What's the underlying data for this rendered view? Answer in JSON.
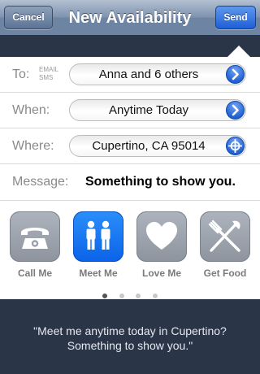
{
  "navbar": {
    "title": "New Availability",
    "cancel_label": "Cancel",
    "send_label": "Send"
  },
  "form": {
    "to": {
      "label": "To:",
      "email_label": "EMAIL",
      "sms_label": "SMS",
      "value": "Anna and 6 others"
    },
    "when": {
      "label": "When:",
      "value": "Anytime Today"
    },
    "where": {
      "label": "Where:",
      "value": "Cupertino, CA 95014"
    },
    "message": {
      "label": "Message:",
      "value": "Something to show you."
    }
  },
  "actions": [
    {
      "label": "Call Me",
      "icon": "phone-icon",
      "selected": false
    },
    {
      "label": "Meet Me",
      "icon": "people-icon",
      "selected": true
    },
    {
      "label": "Love Me",
      "icon": "heart-icon",
      "selected": false
    },
    {
      "label": "Get Food",
      "icon": "fork-knife-icon",
      "selected": false
    }
  ],
  "pager": {
    "page_count": 4,
    "current_page": 1
  },
  "preview": {
    "line1": "\"Meet me anytime today in Cupertino?",
    "line2": "Something to show you.\""
  },
  "colors": {
    "nav_blue": "#6d84a2",
    "send_blue": "#1e5fd6",
    "selected_tile": "#0b63e8",
    "background": "#2b3548"
  }
}
